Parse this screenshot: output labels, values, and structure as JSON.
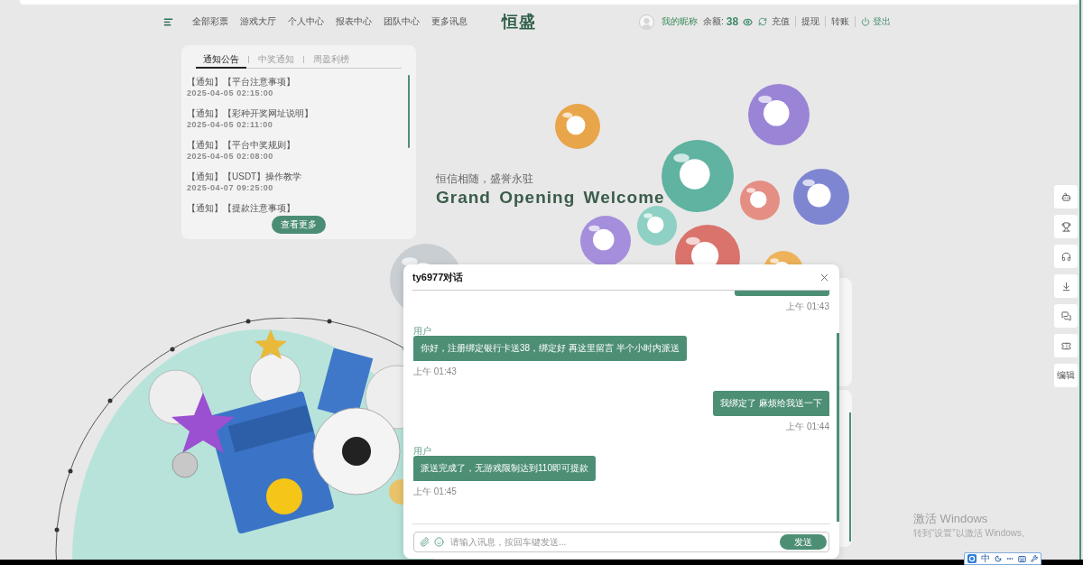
{
  "top_nav": {
    "menu": [
      "全部彩票",
      "游戏大厅",
      "个人中心",
      "报表中心",
      "团队中心",
      "更多讯息"
    ],
    "logo": "恒盛",
    "account": {
      "nickname": "我的昵称",
      "balance_label": "余额:",
      "balance": "38",
      "links": [
        "充值",
        "提现",
        "转账"
      ],
      "logout": "登出"
    }
  },
  "notice_panel": {
    "tabs": [
      {
        "label": "通知公告",
        "selected": true
      },
      {
        "label": "中奖通知",
        "selected": false
      },
      {
        "label": "周盈利榜",
        "selected": false
      }
    ],
    "items": [
      {
        "title": "【通知】【平台注意事项】",
        "date": "2025-04-05 02:15:00"
      },
      {
        "title": "【通知】【彩种开奖网址说明】",
        "date": "2025-04-05 02:11:00"
      },
      {
        "title": "【通知】【平台中奖规则】",
        "date": "2025-04-05 02:08:00"
      },
      {
        "title": "【通知】【USDT】操作教学",
        "date": "2025-04-07 09:25:00"
      },
      {
        "title": "【通知】【提款注意事项】"
      }
    ],
    "more_button": "查看更多"
  },
  "banner": {
    "subtitle": "恒信相随，盛誉永驻",
    "title": "Grand Opening Welcome"
  },
  "chat_dialog": {
    "title": "ty6977对话",
    "messages": [
      {
        "kind": "sent",
        "time": "上午 01:43"
      },
      {
        "kind": "received",
        "sender": "用户",
        "text": "你好，注册绑定银行卡送38，绑定好 再这里留言 半个小时内派送",
        "time": "上午 01:43"
      },
      {
        "kind": "sent",
        "text": "我绑定了 麻烦给我送一下",
        "time": "上午 01:44"
      },
      {
        "kind": "received",
        "sender": "用户",
        "text": "派送完成了，无游戏限制达到110即可提款",
        "time": "上午 01:45"
      }
    ],
    "input": {
      "placeholder": "请输入讯息，按回车键发送..."
    },
    "send_button": "发送"
  },
  "side_toolbar": {
    "text_button": "编辑"
  },
  "ime_toolbar": {
    "mode": "中"
  },
  "os_notice": {
    "title": "激活 Windows",
    "text": "转到“设置”以激活 Windows。"
  }
}
